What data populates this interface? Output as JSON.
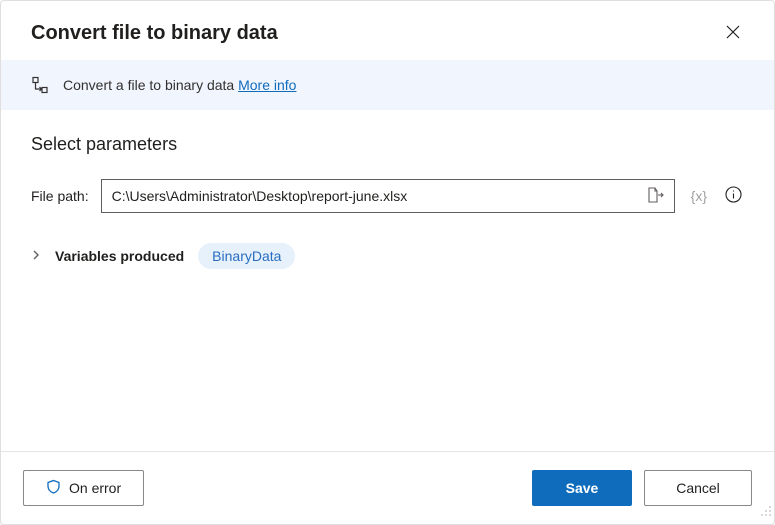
{
  "dialog": {
    "title": "Convert file to binary data"
  },
  "banner": {
    "text": "Convert a file to binary data ",
    "link": "More info"
  },
  "section": {
    "title": "Select parameters"
  },
  "field": {
    "label": "File path:",
    "value": "C:\\Users\\Administrator\\Desktop\\report-june.xlsx",
    "var_token": "{x}"
  },
  "variables": {
    "label": "Variables produced",
    "pill": "BinaryData"
  },
  "footer": {
    "on_error": "On error",
    "save": "Save",
    "cancel": "Cancel"
  }
}
